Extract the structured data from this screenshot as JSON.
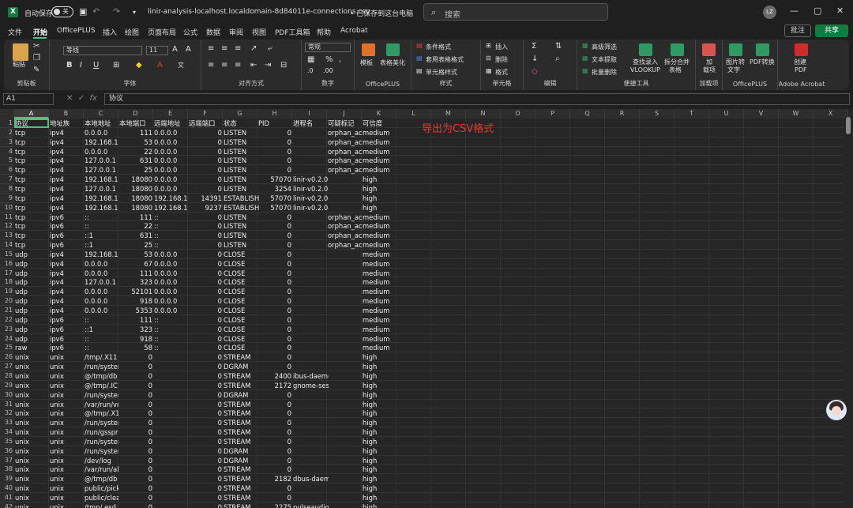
{
  "titlebar": {
    "autosave_label": "自动保存",
    "autosave_state": "关",
    "filename": "linir-analysis-localhost.localdomain-8d84011e-connections.csv -...",
    "save_status": "• 已保存到这台电脑",
    "search_placeholder": "搜索",
    "user_initials": "LZ"
  },
  "menu": {
    "tabs": [
      "文件",
      "开始",
      "OfficePLUS",
      "插入",
      "绘图",
      "页面布局",
      "公式",
      "数据",
      "审阅",
      "视图",
      "PDF工具箱",
      "帮助",
      "Acrobat"
    ],
    "active": "开始",
    "comment_label": "批注",
    "share_label": "共享"
  },
  "ribbon": {
    "clipboard": {
      "paste": "粘贴",
      "label": "剪贴板"
    },
    "font": {
      "name": "等线",
      "size": "11",
      "bold": "B",
      "italic": "I",
      "underline": "U",
      "label": "字体"
    },
    "alignment": {
      "label": "对齐方式"
    },
    "number": {
      "format": "常规",
      "label": "数字"
    },
    "officeplus1": {
      "template": "模板",
      "beautify": "表格美化",
      "label": "OfficePLUS"
    },
    "styles": {
      "cond": "条件格式",
      "table": "套用表格格式",
      "cell": "单元格样式",
      "label": "样式"
    },
    "cells": {
      "insert": "插入",
      "delete": "删除",
      "format": "格式",
      "label": "单元格"
    },
    "editing": {
      "label": "编辑"
    },
    "tools": {
      "filter": "高级筛选",
      "extract": "文本提取",
      "batch": "批量删除",
      "lookup1": "查找录入",
      "lookup2": "VLOOKUP",
      "split1": "拆分合并",
      "split2": "表格",
      "label": "便捷工具"
    },
    "addin": {
      "add1": "加",
      "add2": "载项",
      "label": "加载项"
    },
    "officeplus2": {
      "img1": "图片转",
      "img2": "文字",
      "pdf1": "PDF转换",
      "label": "OfficePLUS"
    },
    "acrobat": {
      "create1": "创建",
      "create2": "PDF",
      "label": "Adobe Acrobat"
    }
  },
  "formula_bar": {
    "cell_ref": "A1",
    "fx": "fx",
    "content": "协议"
  },
  "columns": [
    "A",
    "B",
    "C",
    "D",
    "E",
    "F",
    "G",
    "H",
    "I",
    "J",
    "K",
    "L",
    "M",
    "N",
    "O",
    "P",
    "Q",
    "R",
    "S",
    "T",
    "U",
    "V",
    "W",
    "X"
  ],
  "rows": [
    [
      "协议",
      "地址族",
      "本地地址",
      "本地端口",
      "远端地址",
      "远端端口",
      "状态",
      "PID",
      "进程名",
      "可疑标记",
      "可信度"
    ],
    [
      "tcp",
      "ipv4",
      "0.0.0.0",
      "111",
      "0.0.0.0",
      "0",
      "LISTEN",
      "0",
      "",
      "orphan_ac",
      "medium"
    ],
    [
      "tcp",
      "ipv4",
      "192.168.12",
      "53",
      "0.0.0.0",
      "0",
      "LISTEN",
      "0",
      "",
      "orphan_ac",
      "medium"
    ],
    [
      "tcp",
      "ipv4",
      "0.0.0.0",
      "22",
      "0.0.0.0",
      "0",
      "LISTEN",
      "0",
      "",
      "orphan_ac",
      "medium"
    ],
    [
      "tcp",
      "ipv4",
      "127.0.0.1",
      "631",
      "0.0.0.0",
      "0",
      "LISTEN",
      "0",
      "",
      "orphan_ac",
      "medium"
    ],
    [
      "tcp",
      "ipv4",
      "127.0.0.1",
      "25",
      "0.0.0.0",
      "0",
      "LISTEN",
      "0",
      "",
      "orphan_ac",
      "medium"
    ],
    [
      "tcp",
      "ipv4",
      "192.168.13",
      "18080",
      "0.0.0.0",
      "0",
      "LISTEN",
      "57070",
      "linir-v0.2.0-li",
      "",
      "high"
    ],
    [
      "tcp",
      "ipv4",
      "127.0.0.1",
      "18080",
      "0.0.0.0",
      "0",
      "LISTEN",
      "3254",
      "linir-v0.2.0-li",
      "",
      "high"
    ],
    [
      "tcp",
      "ipv4",
      "192.168.13",
      "18080",
      "192.168.13",
      "14391",
      "ESTABLISH",
      "57070",
      "linir-v0.2.0-li",
      "",
      "high"
    ],
    [
      "tcp",
      "ipv4",
      "192.168.13",
      "18080",
      "192.168.13",
      "9237",
      "ESTABLISH",
      "57070",
      "linir-v0.2.0-li",
      "",
      "high"
    ],
    [
      "tcp",
      "ipv6",
      "::",
      "111",
      "::",
      "0",
      "LISTEN",
      "0",
      "",
      "orphan_ac",
      "medium"
    ],
    [
      "tcp",
      "ipv6",
      "::",
      "22",
      "::",
      "0",
      "LISTEN",
      "0",
      "",
      "orphan_ac",
      "medium"
    ],
    [
      "tcp",
      "ipv6",
      "::1",
      "631",
      "::",
      "0",
      "LISTEN",
      "0",
      "",
      "orphan_ac",
      "medium"
    ],
    [
      "tcp",
      "ipv6",
      "::1",
      "25",
      "::",
      "0",
      "LISTEN",
      "0",
      "",
      "orphan_ac",
      "medium"
    ],
    [
      "udp",
      "ipv4",
      "192.168.12",
      "53",
      "0.0.0.0",
      "0",
      "CLOSE",
      "0",
      "",
      "",
      "medium"
    ],
    [
      "udp",
      "ipv4",
      "0.0.0.0",
      "67",
      "0.0.0.0",
      "0",
      "CLOSE",
      "0",
      "",
      "",
      "medium"
    ],
    [
      "udp",
      "ipv4",
      "0.0.0.0",
      "111",
      "0.0.0.0",
      "0",
      "CLOSE",
      "0",
      "",
      "",
      "medium"
    ],
    [
      "udp",
      "ipv4",
      "127.0.0.1",
      "323",
      "0.0.0.0",
      "0",
      "CLOSE",
      "0",
      "",
      "",
      "medium"
    ],
    [
      "udp",
      "ipv4",
      "0.0.0.0",
      "52101",
      "0.0.0.0",
      "0",
      "CLOSE",
      "0",
      "",
      "",
      "medium"
    ],
    [
      "udp",
      "ipv4",
      "0.0.0.0",
      "918",
      "0.0.0.0",
      "0",
      "CLOSE",
      "0",
      "",
      "",
      "medium"
    ],
    [
      "udp",
      "ipv4",
      "0.0.0.0",
      "5353",
      "0.0.0.0",
      "0",
      "CLOSE",
      "0",
      "",
      "",
      "medium"
    ],
    [
      "udp",
      "ipv6",
      "::",
      "111",
      "::",
      "0",
      "CLOSE",
      "0",
      "",
      "",
      "medium"
    ],
    [
      "udp",
      "ipv6",
      "::1",
      "323",
      "::",
      "0",
      "CLOSE",
      "0",
      "",
      "",
      "medium"
    ],
    [
      "udp",
      "ipv6",
      "::",
      "918",
      "::",
      "0",
      "CLOSE",
      "0",
      "",
      "",
      "medium"
    ],
    [
      "raw",
      "ipv6",
      "::",
      "58",
      "::",
      "0",
      "CLOSE",
      "0",
      "",
      "",
      "medium"
    ],
    [
      "unix",
      "unix",
      "/tmp/.X11",
      "0",
      "",
      "0",
      "STREAM",
      "0",
      "",
      "",
      "high"
    ],
    [
      "unix",
      "unix",
      "/run/syster",
      "0",
      "",
      "0",
      "DGRAM",
      "0",
      "",
      "",
      "high"
    ],
    [
      "unix",
      "unix",
      "@/tmp/db",
      "0",
      "",
      "0",
      "STREAM",
      "2400",
      "ibus-daemon",
      "",
      "high"
    ],
    [
      "unix",
      "unix",
      "@/tmp/.IC",
      "0",
      "",
      "0",
      "STREAM",
      "2172",
      "gnome-session-b",
      "",
      "high"
    ],
    [
      "unix",
      "unix",
      "/run/syster",
      "0",
      "",
      "0",
      "DGRAM",
      "0",
      "",
      "",
      "high"
    ],
    [
      "unix",
      "unix",
      "/var/run/vr",
      "0",
      "",
      "0",
      "STREAM",
      "0",
      "",
      "",
      "high"
    ],
    [
      "unix",
      "unix",
      "@/tmp/.X1",
      "0",
      "",
      "0",
      "STREAM",
      "0",
      "",
      "",
      "high"
    ],
    [
      "unix",
      "unix",
      "/run/syster",
      "0",
      "",
      "0",
      "STREAM",
      "0",
      "",
      "",
      "high"
    ],
    [
      "unix",
      "unix",
      "/run/gsspr",
      "0",
      "",
      "0",
      "STREAM",
      "0",
      "",
      "",
      "high"
    ],
    [
      "unix",
      "unix",
      "/run/syster",
      "0",
      "",
      "0",
      "STREAM",
      "0",
      "",
      "",
      "high"
    ],
    [
      "unix",
      "unix",
      "/run/syster",
      "0",
      "",
      "0",
      "DGRAM",
      "0",
      "",
      "",
      "high"
    ],
    [
      "unix",
      "unix",
      "/dev/log",
      "0",
      "",
      "0",
      "DGRAM",
      "0",
      "",
      "",
      "high"
    ],
    [
      "unix",
      "unix",
      "/var/run/ab",
      "0",
      "",
      "0",
      "STREAM",
      "0",
      "",
      "",
      "high"
    ],
    [
      "unix",
      "unix",
      "@/tmp/db",
      "0",
      "",
      "0",
      "STREAM",
      "2182",
      "dbus-daemon",
      "",
      "high"
    ],
    [
      "unix",
      "unix",
      "public/pick",
      "0",
      "",
      "0",
      "STREAM",
      "0",
      "",
      "",
      "high"
    ],
    [
      "unix",
      "unix",
      "public/clea",
      "0",
      "",
      "0",
      "STREAM",
      "0",
      "",
      "",
      "high"
    ],
    [
      "unix",
      "unix",
      "/tmp/.esd",
      "0",
      "",
      "0",
      "STREAM",
      "2275",
      "pulseaudio",
      "",
      "high"
    ]
  ],
  "annotation": "导出为CSV格式"
}
